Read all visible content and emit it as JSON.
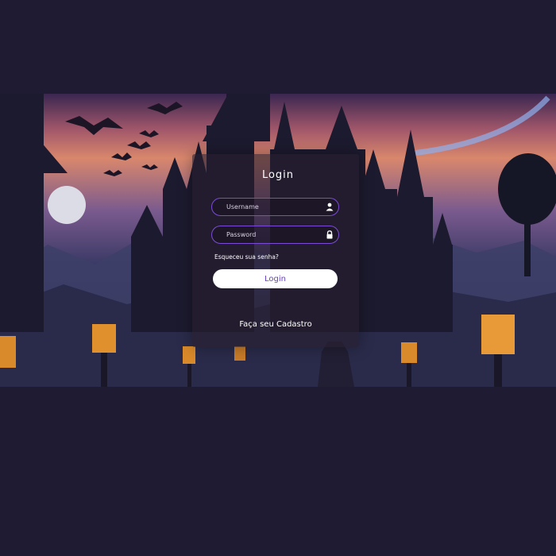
{
  "login_card": {
    "title": "Login",
    "username_placeholder": "Username",
    "password_placeholder": "Password",
    "forgot_password": "Esqueceu sua senha?",
    "login_button": "Login",
    "signup_link": "Faça seu Cadastro"
  },
  "icons": {
    "username": "user-icon",
    "password": "lock-icon"
  },
  "colors": {
    "page_background": "#1f1b33",
    "input_border": "#7a4cd6",
    "button_background": "#ffffff",
    "button_text": "#6a3fc8",
    "text": "#ffffff"
  }
}
